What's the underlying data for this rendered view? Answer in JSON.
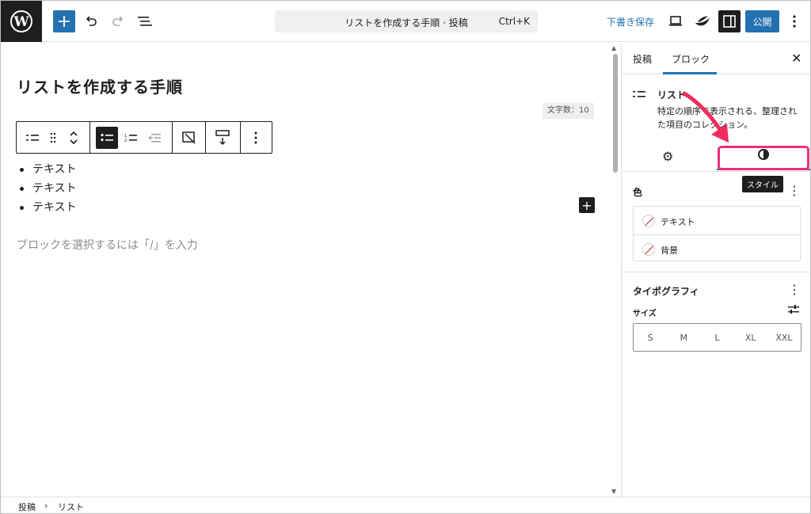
{
  "topbar": {
    "document_title": "リストを作成する手順 · 投稿",
    "shortcut": "Ctrl+K",
    "save_draft": "下書き保存",
    "publish": "公開"
  },
  "editor": {
    "post_title": "リストを作成する手順",
    "word_count": "文字数：10",
    "list_items": [
      "テキスト",
      "テキスト",
      "テキスト"
    ],
    "placeholder": "ブロックを選択するには「/」を入力"
  },
  "sidebar": {
    "tabs": [
      "投稿",
      "ブロック"
    ],
    "block_name": "リスト",
    "block_description": "特定の順序で表示される、整理された項目のコレクション。",
    "tooltip": "スタイル",
    "color": {
      "title": "色",
      "items": [
        "テキスト",
        "背景"
      ]
    },
    "typography": {
      "title": "タイポグラフィ",
      "size_label": "サイズ",
      "sizes": [
        "S",
        "M",
        "L",
        "XL",
        "XXL"
      ]
    }
  },
  "breadcrumb": [
    "投稿",
    "リスト"
  ],
  "colors": {
    "accent": "#2271b1",
    "highlight": "#ef2c7c",
    "dark": "#1e1e1e"
  }
}
